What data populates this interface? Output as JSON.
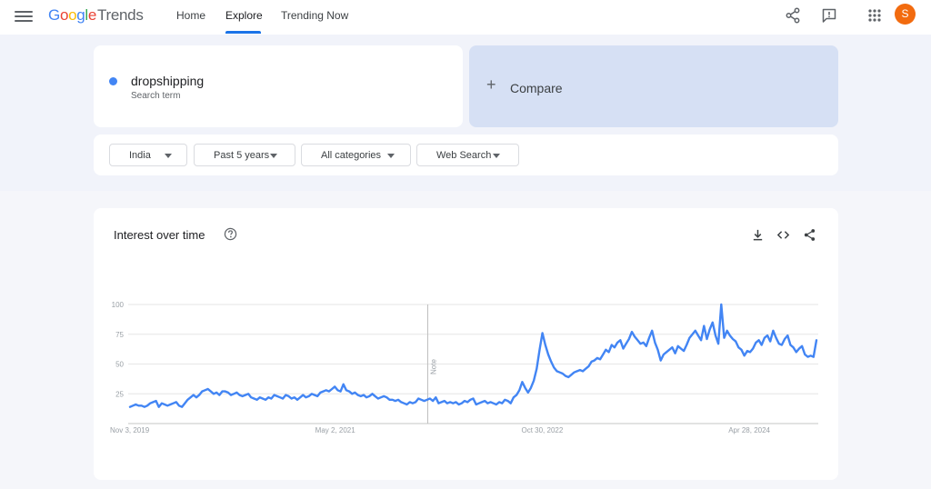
{
  "header": {
    "logo_google": "Google",
    "logo_trends": "Trends",
    "nav": [
      "Home",
      "Explore",
      "Trending Now"
    ],
    "active_nav": "Explore",
    "avatar_letter": "S",
    "icons": [
      "menu-icon",
      "share-icon",
      "feedback-icon",
      "apps-icon"
    ]
  },
  "term": {
    "name": "dropshipping",
    "subtitle": "Search term",
    "color": "#4285f4"
  },
  "compare": {
    "label": "Compare"
  },
  "filters": {
    "region": "India",
    "time": "Past 5 years",
    "category": "All categories",
    "search_type": "Web Search"
  },
  "chart_card": {
    "title": "Interest over time",
    "icons": [
      "help-icon",
      "download-icon",
      "embed-icon",
      "share-icon"
    ]
  },
  "chart_data": {
    "type": "line",
    "title": "",
    "xlabel": "",
    "ylabel": "",
    "ylim": [
      0,
      100
    ],
    "yticks": [
      25,
      50,
      75,
      100
    ],
    "xtick_labels": [
      "Nov 3, 2019",
      "May 2, 2021",
      "Oct 30, 2022",
      "Apr 28, 2024"
    ],
    "x_range": [
      "Nov 3, 2019",
      "Oct 27, 2024"
    ],
    "note_label": "Note",
    "note_at": "Jan 2022",
    "grid": true,
    "legend": "none",
    "series": [
      {
        "color": "#4285f4",
        "values": [
          14,
          15,
          16,
          15,
          15,
          14,
          15,
          17,
          18,
          19,
          14,
          17,
          16,
          15,
          16,
          17,
          18,
          15,
          14,
          17,
          20,
          22,
          24,
          22,
          24,
          27,
          28,
          29,
          27,
          25,
          26,
          24,
          27,
          27,
          26,
          24,
          25,
          26,
          24,
          23,
          24,
          25,
          22,
          21,
          20,
          22,
          21,
          20,
          22,
          21,
          24,
          23,
          22,
          21,
          24,
          23,
          21,
          22,
          20,
          22,
          24,
          22,
          23,
          25,
          24,
          23,
          26,
          27,
          28,
          27,
          29,
          31,
          28,
          27,
          33,
          28,
          27,
          25,
          26,
          24,
          23,
          24,
          22,
          23,
          25,
          23,
          21,
          22,
          23,
          22,
          20,
          20,
          19,
          20,
          18,
          17,
          16,
          18,
          17,
          18,
          21,
          20,
          19,
          20,
          21,
          19,
          22,
          17,
          18,
          19,
          17,
          18,
          17,
          18,
          16,
          17,
          19,
          18,
          20,
          21,
          16,
          17,
          18,
          19,
          17,
          18,
          17,
          16,
          18,
          17,
          20,
          19,
          17,
          22,
          24,
          28,
          35,
          30,
          26,
          30,
          36,
          46,
          62,
          76,
          66,
          58,
          52,
          47,
          44,
          43,
          42,
          40,
          39,
          41,
          43,
          44,
          45,
          44,
          46,
          48,
          52,
          53,
          55,
          54,
          58,
          62,
          60,
          66,
          64,
          68,
          70,
          63,
          67,
          71,
          77,
          73,
          70,
          67,
          68,
          65,
          72,
          78,
          68,
          62,
          53,
          58,
          60,
          62,
          64,
          59,
          65,
          63,
          61,
          66,
          72,
          75,
          78,
          74,
          70,
          82,
          71,
          79,
          85,
          74,
          67,
          100,
          72,
          78,
          74,
          71,
          69,
          64,
          62,
          57,
          61,
          60,
          63,
          68,
          70,
          66,
          72,
          74,
          69,
          78,
          72,
          67,
          66,
          71,
          74,
          66,
          64,
          60,
          63,
          65,
          58,
          56,
          57,
          56,
          70
        ]
      }
    ]
  }
}
